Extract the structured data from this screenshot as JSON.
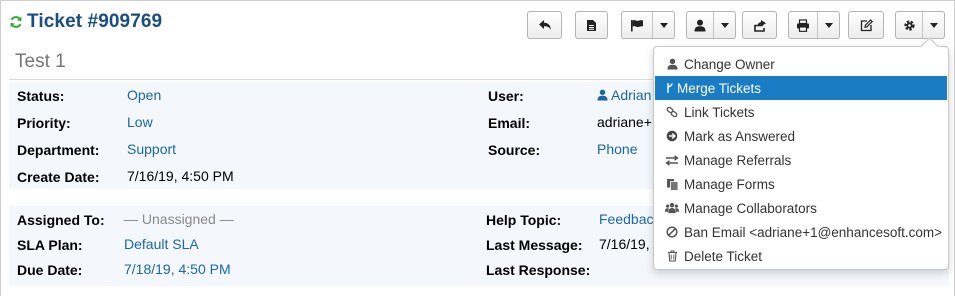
{
  "ticket": {
    "title": "Ticket #909769",
    "subject": "Test 1"
  },
  "toolbar": {
    "buttons": [
      {
        "name": "back-button",
        "icon": "reply-icon"
      },
      {
        "name": "file-button",
        "icon": "file-icon"
      },
      {
        "name": "flag-button",
        "icon": "flag-icon"
      },
      {
        "name": "assign-button",
        "icon": "user-icon"
      },
      {
        "name": "transfer-button",
        "icon": "share-icon"
      },
      {
        "name": "print-button",
        "icon": "print-icon"
      },
      {
        "name": "edit-button",
        "icon": "edit-icon"
      },
      {
        "name": "settings-button",
        "icon": "gear-icon"
      }
    ]
  },
  "info_left": [
    {
      "label": "Status:",
      "value": "Open"
    },
    {
      "label": "Priority:",
      "value": "Low"
    },
    {
      "label": "Department:",
      "value": "Support"
    },
    {
      "label": "Create Date:",
      "value": "7/16/19, 4:50 PM"
    }
  ],
  "info_right": [
    {
      "label": "User:",
      "value": "Adrian"
    },
    {
      "label": "Email:",
      "value": "adriane+"
    },
    {
      "label": "Source:",
      "value": "Phone"
    }
  ],
  "assign_left": [
    {
      "label": "Assigned To:",
      "value": "— Unassigned —"
    },
    {
      "label": "SLA Plan:",
      "value": "Default SLA"
    },
    {
      "label": "Due Date:",
      "value": "7/18/19, 4:50 PM"
    }
  ],
  "assign_right": [
    {
      "label": "Help Topic:",
      "value": "Feedbac"
    },
    {
      "label": "Last Message:",
      "value": "7/16/19,"
    },
    {
      "label": "Last Response:",
      "value": ""
    }
  ],
  "dropdown": {
    "items": [
      {
        "label": "Change Owner",
        "icon": "user-icon"
      },
      {
        "label": "Merge Tickets",
        "icon": "merge-icon",
        "active": true
      },
      {
        "label": "Link Tickets",
        "icon": "link-icon"
      },
      {
        "label": "Mark as Answered",
        "icon": "arrow-circle-icon"
      },
      {
        "label": "Manage Referrals",
        "icon": "exchange-icon"
      },
      {
        "label": "Manage Forms",
        "icon": "copy-icon"
      },
      {
        "label": "Manage Collaborators",
        "icon": "group-icon"
      },
      {
        "label": "Ban Email <adriane+1@enhancesoft.com>",
        "icon": "ban-icon"
      },
      {
        "label": "Delete Ticket",
        "icon": "trash-icon"
      }
    ]
  },
  "colors": {
    "title": "#184e81",
    "link": "#1a66a6",
    "active": "#1a7cc4",
    "refresh": "#2eaa2e"
  }
}
